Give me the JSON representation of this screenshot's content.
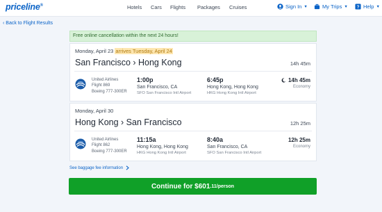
{
  "header": {
    "logo": "priceline",
    "nav": [
      "Hotels",
      "Cars",
      "Flights",
      "Packages",
      "Cruises"
    ],
    "sign_in": "Sign In",
    "my_trips": "My Trips",
    "help": "Help"
  },
  "back_link": "‹ Back to Flight Results",
  "banner": "Free online cancellation within the next 24 hours!",
  "legs": [
    {
      "date": "Monday, April 23",
      "date_note": "arrives Tuesday, April 24",
      "route": "San Francisco › Hong Kong",
      "total_duration": "14h 45m",
      "airline": "United Airlines",
      "flight": "Flight 869",
      "aircraft": "Boeing 777-300ER",
      "depart_time": "1:00p",
      "depart_city": "San Francisco, CA",
      "depart_airport": "SFO San Francisco Intl Airport",
      "arrive_time": "6:45p",
      "arrive_city": "Hong Kong, Hong Kong",
      "arrive_airport": "HKG Hong Kong Intl Airport",
      "segment_duration": "14h 45m",
      "cabin": "Economy",
      "overnight_icon": "moon-icon"
    },
    {
      "date": "Monday, April 30",
      "route": "Hong Kong › San Francisco",
      "total_duration": "12h 25m",
      "airline": "United Airlines",
      "flight": "Flight 862",
      "aircraft": "Boeing 777-300ER",
      "depart_time": "11:15a",
      "depart_city": "Hong Kong, Hong Kong",
      "depart_airport": "HKG Hong Kong Intl Airport",
      "arrive_time": "8:40a",
      "arrive_city": "San Francisco, CA",
      "arrive_airport": "SFO San Francisco Intl Airport",
      "segment_duration": "12h 25m",
      "cabin": "Economy"
    }
  ],
  "baggage_link": "See baggage fee information",
  "continue": {
    "label": "Continue for $601",
    "price_suffix": ".11/person"
  },
  "colors": {
    "brand_blue": "#0a63c7",
    "continue_green": "#10a028",
    "banner_green": "#d8f2d8",
    "highlight": "#fde6b0",
    "airline_logo": "#1a5ba8"
  }
}
